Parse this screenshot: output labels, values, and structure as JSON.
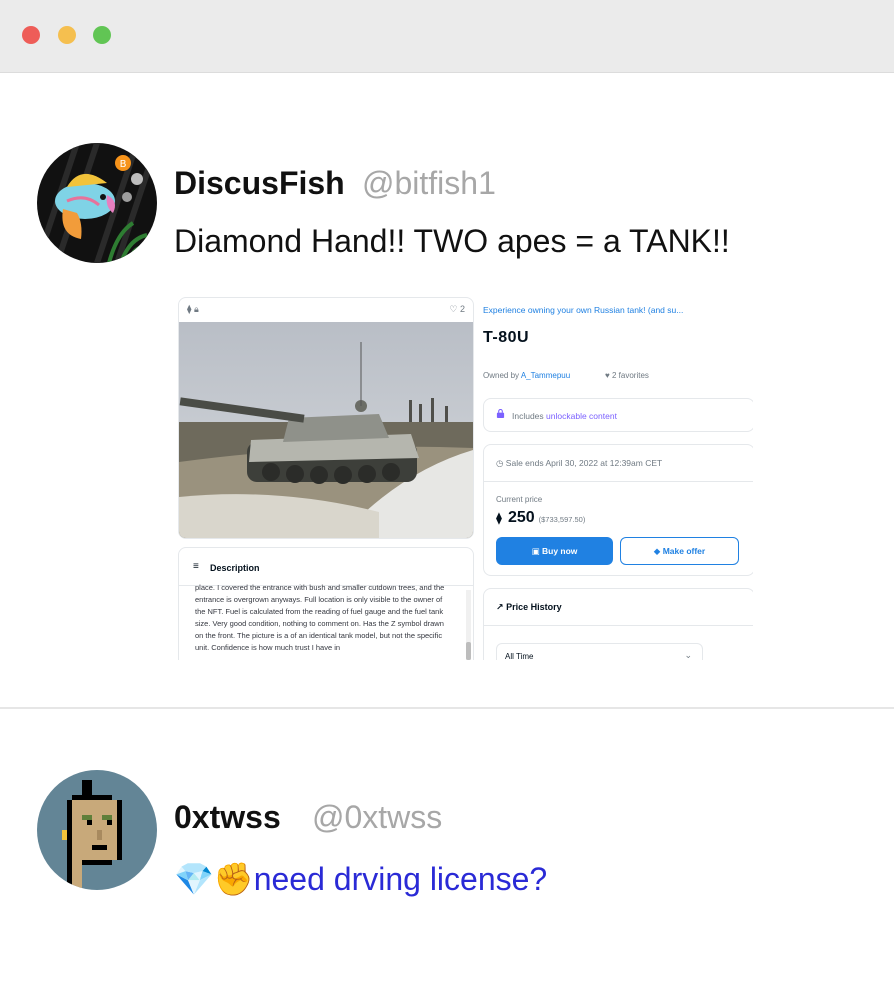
{
  "window": {
    "controls": [
      "close",
      "minimize",
      "maximize"
    ]
  },
  "tweets": [
    {
      "name": "DiscusFish",
      "handle": "@bitfish1",
      "text": "Diamond Hand!! TWO apes = a TANK!!",
      "embed": {
        "image_card": {
          "chain_icon": "ethereum-icon",
          "lock_icon": "lock-icon",
          "favorites_count": "♡ 2"
        },
        "description_header": "Description",
        "description_text": "place. I covered the entrance with bush and smaller cutdown trees, and the entrance is overgrown anyways. Full location is only visible to the owner of the NFT. Fuel is calculated from the reading of fuel gauge and the fuel tank size. Very good condition, nothing to comment on. Has the Z symbol drawn on the front. The picture is a of an identical tank model, but not the specific unit. Confidence is how much trust I have in",
        "collection": "Experience owning your own Russian tank! (and su...",
        "title": "T-80U",
        "owned_by_label": "Owned by",
        "owner": "A_Tammepuu",
        "favorites": "2 favorites",
        "unlockable_prefix": "Includes",
        "unlockable_text": "unlockable content",
        "sale_ends": "Sale ends April 30, 2022 at 12:39am CET",
        "current_price_label": "Current price",
        "price": "250",
        "price_usd": "($733,597.50)",
        "buy_label": "Buy now",
        "offer_label": "Make offer",
        "price_history_label": "Price History",
        "time_filter": "All Time"
      }
    },
    {
      "name": "0xtwss",
      "handle": "@0xtwss",
      "emoji": "💎✊",
      "text": "need drving license?",
      "text_color": "#2a2ad6"
    }
  ]
}
